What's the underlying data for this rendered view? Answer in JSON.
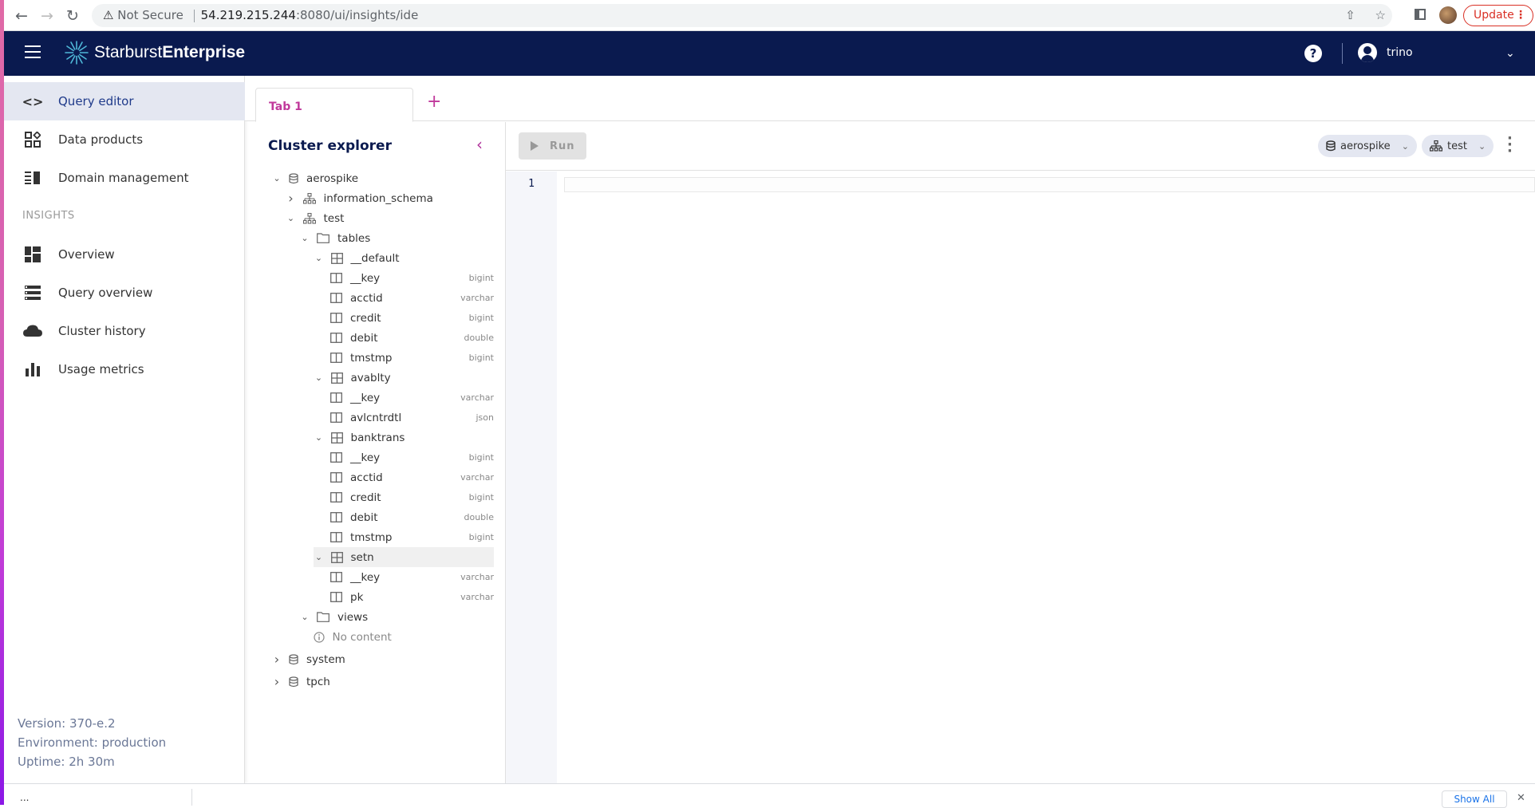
{
  "browser": {
    "security_label": "Not Secure",
    "url_host": "54.219.215.244",
    "url_path": ":8080/ui/insights/ide",
    "update_label": "Update"
  },
  "header": {
    "brand_light": "Starburst",
    "brand_bold": "Enterprise",
    "help_label": "?",
    "user_name": "trino"
  },
  "sidebar": {
    "items": [
      {
        "label": "Query editor",
        "icon": "code-icon",
        "active": true
      },
      {
        "label": "Data products",
        "icon": "data-products-icon"
      },
      {
        "label": "Domain management",
        "icon": "domain-icon"
      }
    ],
    "section_label": "INSIGHTS",
    "insight_items": [
      {
        "label": "Overview",
        "icon": "dashboard-icon"
      },
      {
        "label": "Query overview",
        "icon": "list-icon"
      },
      {
        "label": "Cluster history",
        "icon": "cloud-icon"
      },
      {
        "label": "Usage metrics",
        "icon": "bar-chart-icon"
      }
    ],
    "meta": {
      "version": "Version: 370-e.2",
      "environment": "Environment: production",
      "uptime": "Uptime: 2h 30m"
    }
  },
  "tabs": {
    "items": [
      {
        "label": "Tab 1",
        "active": true
      }
    ],
    "add_label": "+"
  },
  "explorer": {
    "title": "Cluster explorer",
    "tree": [
      {
        "label": "aerospike",
        "kind": "catalog",
        "expanded": true,
        "depth": 0
      },
      {
        "label": "information_schema",
        "kind": "schema",
        "expanded": false,
        "depth": 1
      },
      {
        "label": "test",
        "kind": "schema",
        "expanded": true,
        "depth": 1
      },
      {
        "label": "tables",
        "kind": "folder",
        "expanded": true,
        "depth": 2
      },
      {
        "label": "__default",
        "kind": "table",
        "expanded": true,
        "depth": 3
      },
      {
        "label": "__key",
        "kind": "column",
        "type": "bigint",
        "depth": 4
      },
      {
        "label": "acctid",
        "kind": "column",
        "type": "varchar",
        "depth": 4
      },
      {
        "label": "credit",
        "kind": "column",
        "type": "bigint",
        "depth": 4
      },
      {
        "label": "debit",
        "kind": "column",
        "type": "double",
        "depth": 4
      },
      {
        "label": "tmstmp",
        "kind": "column",
        "type": "bigint",
        "depth": 4
      },
      {
        "label": "avablty",
        "kind": "table",
        "expanded": true,
        "depth": 3
      },
      {
        "label": "__key",
        "kind": "column",
        "type": "varchar",
        "depth": 4
      },
      {
        "label": "avlcntrdtl",
        "kind": "column",
        "type": "json",
        "depth": 4
      },
      {
        "label": "banktrans",
        "kind": "table",
        "expanded": true,
        "depth": 3
      },
      {
        "label": "__key",
        "kind": "column",
        "type": "bigint",
        "depth": 4
      },
      {
        "label": "acctid",
        "kind": "column",
        "type": "varchar",
        "depth": 4
      },
      {
        "label": "credit",
        "kind": "column",
        "type": "bigint",
        "depth": 4
      },
      {
        "label": "debit",
        "kind": "column",
        "type": "double",
        "depth": 4
      },
      {
        "label": "tmstmp",
        "kind": "column",
        "type": "bigint",
        "depth": 4
      },
      {
        "label": "setn",
        "kind": "table",
        "expanded": true,
        "depth": 3,
        "selected": true
      },
      {
        "label": "__key",
        "kind": "column",
        "type": "varchar",
        "depth": 4
      },
      {
        "label": "pk",
        "kind": "column",
        "type": "varchar",
        "depth": 4
      },
      {
        "label": "views",
        "kind": "folder",
        "expanded": true,
        "depth": 2
      },
      {
        "label": "No content",
        "kind": "empty",
        "depth": 3
      },
      {
        "label": "system",
        "kind": "catalog",
        "expanded": false,
        "depth": 0
      },
      {
        "label": "tpch",
        "kind": "catalog",
        "expanded": false,
        "depth": 0
      }
    ]
  },
  "editor": {
    "run_label": "Run",
    "catalog_select": "aerospike",
    "schema_select": "test",
    "line_numbers": [
      "1"
    ],
    "code": ""
  },
  "downloads": {
    "file_label": "...",
    "show_all_label": "Show All",
    "close_label": "✕"
  }
}
